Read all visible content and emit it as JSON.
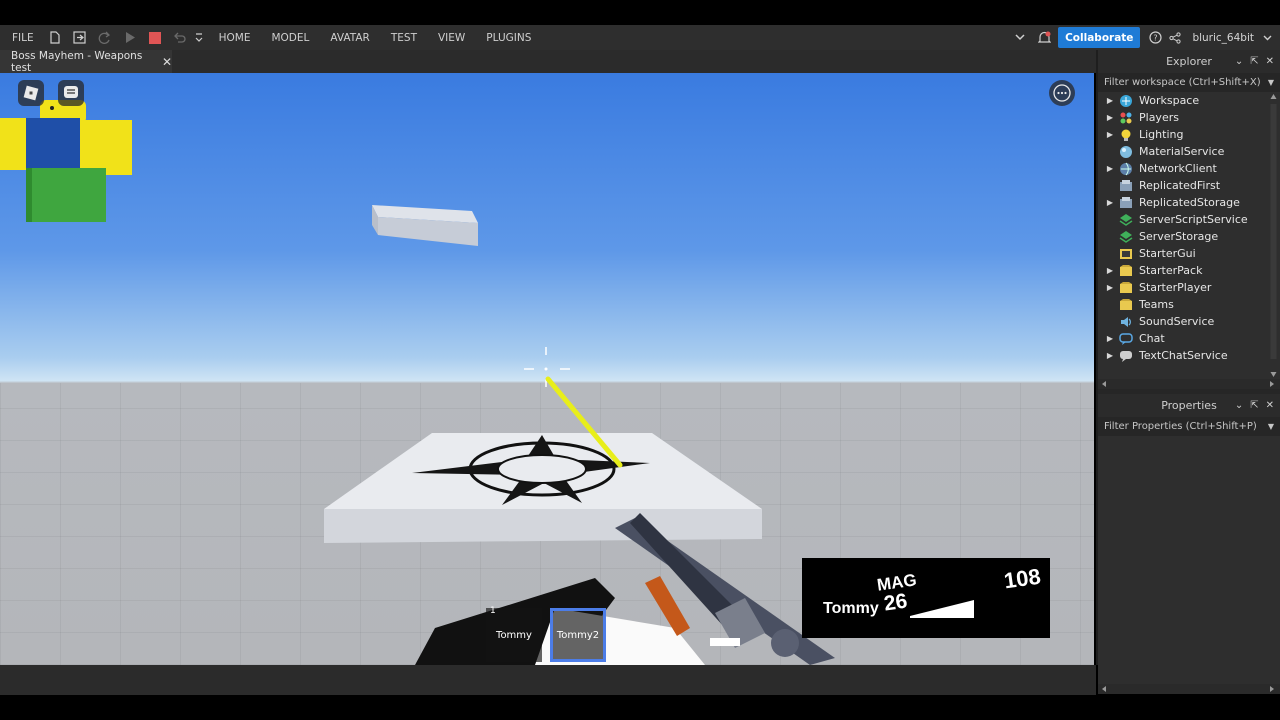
{
  "menubar": {
    "file": "FILE",
    "items": [
      "HOME",
      "MODEL",
      "AVATAR",
      "TEST",
      "VIEW",
      "PLUGINS"
    ],
    "collaborate": "Collaborate",
    "username": "bluric_64bit"
  },
  "tab": {
    "title": "Boss Mayhem - Weapons test"
  },
  "explorer": {
    "title": "Explorer",
    "filter_placeholder": "Filter workspace (Ctrl+Shift+X)",
    "items": [
      {
        "label": "Workspace",
        "icon": "workspace-icon",
        "expandable": true
      },
      {
        "label": "Players",
        "icon": "players-icon",
        "expandable": true
      },
      {
        "label": "Lighting",
        "icon": "lighting-icon",
        "expandable": true
      },
      {
        "label": "MaterialService",
        "icon": "material-service-icon",
        "expandable": false
      },
      {
        "label": "NetworkClient",
        "icon": "network-client-icon",
        "expandable": true
      },
      {
        "label": "ReplicatedFirst",
        "icon": "replicated-first-icon",
        "expandable": false
      },
      {
        "label": "ReplicatedStorage",
        "icon": "replicated-storage-icon",
        "expandable": true
      },
      {
        "label": "ServerScriptService",
        "icon": "server-script-service-icon",
        "expandable": false
      },
      {
        "label": "ServerStorage",
        "icon": "server-storage-icon",
        "expandable": false
      },
      {
        "label": "StarterGui",
        "icon": "starter-gui-icon",
        "expandable": false
      },
      {
        "label": "StarterPack",
        "icon": "starter-pack-icon",
        "expandable": true
      },
      {
        "label": "StarterPlayer",
        "icon": "starter-player-icon",
        "expandable": true
      },
      {
        "label": "Teams",
        "icon": "teams-icon",
        "expandable": false
      },
      {
        "label": "SoundService",
        "icon": "sound-service-icon",
        "expandable": false
      },
      {
        "label": "Chat",
        "icon": "chat-icon",
        "expandable": true
      },
      {
        "label": "TextChatService",
        "icon": "text-chat-service-icon",
        "expandable": true
      }
    ]
  },
  "properties": {
    "title": "Properties",
    "filter_placeholder": "Filter Properties (Ctrl+Shift+P)"
  },
  "hud": {
    "mag_label": "MAG",
    "reserve": "108",
    "weapon": "Tommy",
    "current": "26"
  },
  "hotbar": {
    "slots": [
      {
        "number": "1",
        "label": "Tommy",
        "selected": false
      },
      {
        "number": "",
        "label": "Tommy2",
        "selected": true
      }
    ]
  },
  "colors": {
    "accent": "#1f7bd6",
    "selected_slot": "#4c7de8",
    "tracer": "#e8ee1a",
    "stop": "#e05555"
  }
}
